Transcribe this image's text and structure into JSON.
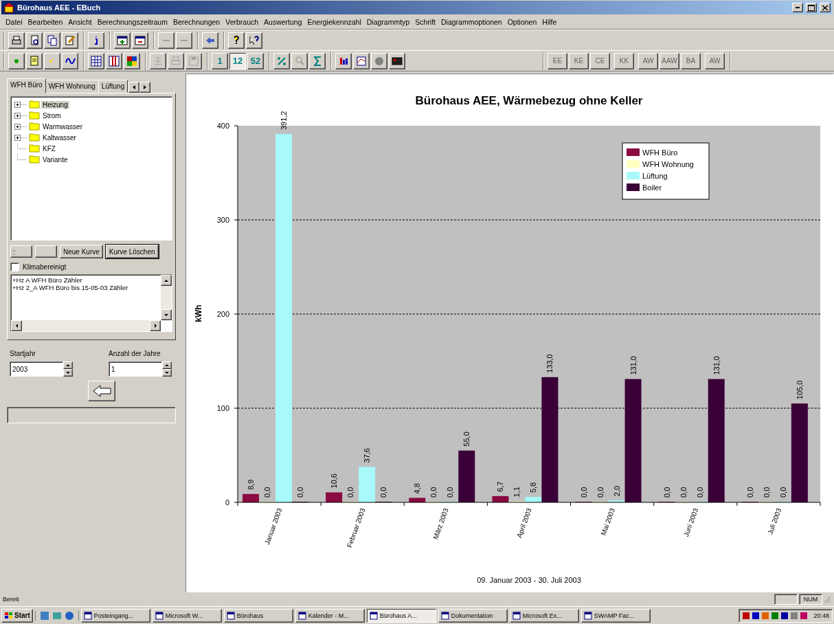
{
  "window": {
    "title": "Bürohaus AEE - EBuch"
  },
  "menu": [
    "Datei",
    "Bearbeiten",
    "Ansicht",
    "Berechnungszeitraum",
    "Berechnungen",
    "Verbrauch",
    "Auswertung",
    "Energiekennzahl",
    "Diagrammtyp",
    "Schrift",
    "Diagrammoptionen",
    "Optionen",
    "Hilfe"
  ],
  "toolbar": {
    "period_buttons": [
      {
        "label": "1",
        "selected": false
      },
      {
        "label": "12",
        "selected": true
      },
      {
        "label": "52",
        "selected": false
      }
    ],
    "report_buttons": [
      {
        "label": "EE",
        "disabled": true
      },
      {
        "label": "KE",
        "disabled": true
      },
      {
        "label": "CE",
        "disabled": true
      },
      {
        "label": "KK",
        "disabled": true
      },
      {
        "label": "AW",
        "disabled": true
      },
      {
        "label": "AAW",
        "disabled": true
      },
      {
        "label": "BA",
        "disabled": true
      },
      {
        "label": "AW",
        "disabled": true
      }
    ]
  },
  "side_panel": {
    "tabs": [
      {
        "label": "WFH Büro",
        "selected": true
      },
      {
        "label": "WFH Wohnung",
        "selected": false
      },
      {
        "label": "Lüftung",
        "selected": false
      }
    ],
    "tree": [
      {
        "label": "Heizung",
        "kind": "collapsible",
        "selected": true
      },
      {
        "label": "Strom",
        "kind": "collapsible",
        "selected": false
      },
      {
        "label": "Warmwasser",
        "kind": "collapsible",
        "selected": false
      },
      {
        "label": "Kaltwasser",
        "kind": "collapsible",
        "selected": false
      },
      {
        "label": "KFZ",
        "kind": "leaf",
        "selected": false
      },
      {
        "label": "Variante",
        "kind": "leaf",
        "selected": false
      }
    ],
    "buttons": [
      {
        "label": "Neue Kurve",
        "default": false
      },
      {
        "label": "Kurve Löschen",
        "default": true
      }
    ],
    "climate_adjusted": {
      "label": "Klimabereinigt",
      "checked": false
    },
    "curves": [
      "+Hz A WFH Büro Zähler",
      "+Hz 2_A WFH Büro bis 15-05-03 Zähler"
    ],
    "start_year": {
      "label": "Startjahr",
      "value": "2003"
    },
    "year_count": {
      "label": "Anzahl der Jahre",
      "value": "1"
    }
  },
  "chart": {
    "chart_data": {
      "type": "bar",
      "title": "Bürohaus AEE, Wärmebezug ohne Keller",
      "xlabel": "09. Januar 2003 - 30. Juli 2003",
      "ylabel": "kWh",
      "categories": [
        "Januar 2003",
        "Februar 2003",
        "März 2003",
        "April 2003",
        "Mai 2003",
        "Juni 2003",
        "Juli 2003"
      ],
      "series": [
        {
          "name": "WFH Büro",
          "color": "#8a0a42",
          "values": [
            8.9,
            10.6,
            4.8,
            6.7,
            0,
            0,
            0
          ],
          "value_labels": [
            "8,9",
            "10,6",
            "4,8",
            "6,7",
            "0,0",
            "0,0",
            "0,0"
          ]
        },
        {
          "name": "WFH Wohnung",
          "color": "#ffffc0",
          "values": [
            0,
            0,
            0,
            1.1,
            0,
            0,
            0
          ],
          "value_labels": [
            "0,0",
            "0,0",
            "0,0",
            "1,1",
            "0,0",
            "0,0",
            "0,0"
          ]
        },
        {
          "name": "Lüftung",
          "color": "#a8fafa",
          "values": [
            391.2,
            37.6,
            0,
            5.8,
            2.0,
            0,
            0
          ],
          "value_labels": [
            "391,2",
            "37,6",
            "0,0",
            "5,8",
            "2,0",
            "0,0",
            "0,0"
          ]
        },
        {
          "name": "Boiler",
          "color": "#3a0038",
          "values": [
            0,
            0,
            55.0,
            133.0,
            131.0,
            131.0,
            105.0
          ],
          "value_labels": [
            "0,0",
            "0,0",
            "55,0",
            "133,0",
            "131,0",
            "131,0",
            "105,0"
          ]
        }
      ],
      "ylim": [
        0,
        400
      ],
      "yticks": [
        0,
        100,
        200,
        300,
        400
      ],
      "grid": true,
      "legend": true
    }
  },
  "status_bar": {
    "text": "Bereit",
    "indicators": [
      "NUM"
    ]
  },
  "taskbar": {
    "start": "Start",
    "tasks": [
      {
        "label": "Posteingang...",
        "selected": false
      },
      {
        "label": "Microsoft W...",
        "selected": false
      },
      {
        "label": "Bürohaus",
        "selected": false
      },
      {
        "label": "Kalender - M...",
        "selected": false
      },
      {
        "label": "Bürohaus A...",
        "selected": true
      },
      {
        "label": "Dokumentation",
        "selected": false
      },
      {
        "label": "Microsoft Ex...",
        "selected": false
      },
      {
        "label": "SWAMP Fac...",
        "selected": false
      }
    ],
    "clock": "20:48"
  }
}
